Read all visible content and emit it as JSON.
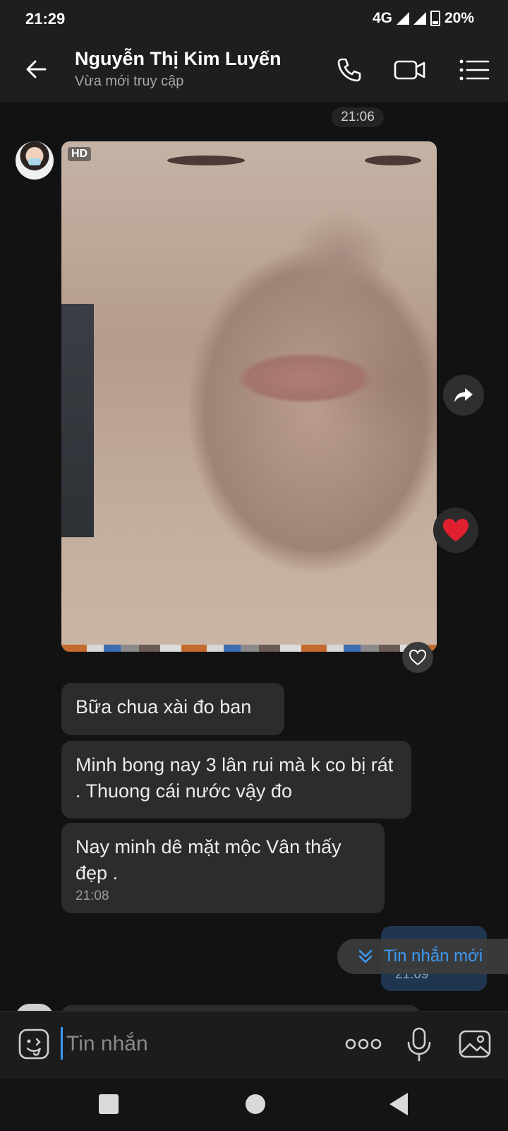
{
  "status": {
    "time": "21:29",
    "network": "4G",
    "battery": "20%"
  },
  "header": {
    "contact_name": "Nguyễn Thị Kim Luyến",
    "presence": "Vừa mới truy cập",
    "icons": [
      "back-arrow-icon",
      "phone-icon",
      "video-call-icon",
      "menu-list-icon"
    ]
  },
  "chat": {
    "date_pill": "21:06",
    "photo": {
      "badge": "HD"
    },
    "messages": [
      {
        "text": "Bữa chua xài đo ban",
        "time": ""
      },
      {
        "text": "Minh bong nay 3 lân rui mà k co bị rát . Thuong cái nước vậy đo",
        "time": ""
      },
      {
        "text": "Nay minh dê mặt mộc Vân thấy đẹp .",
        "time": "21:08"
      }
    ],
    "sent_time": "21:09",
    "new_messages_label": "Tin nhắn mới"
  },
  "composer": {
    "placeholder": "Tin nhắn"
  },
  "colors": {
    "accent": "#3d9bf5",
    "background": "#121212",
    "bubble": "#2c2c2c",
    "heart": "#e0202e"
  }
}
